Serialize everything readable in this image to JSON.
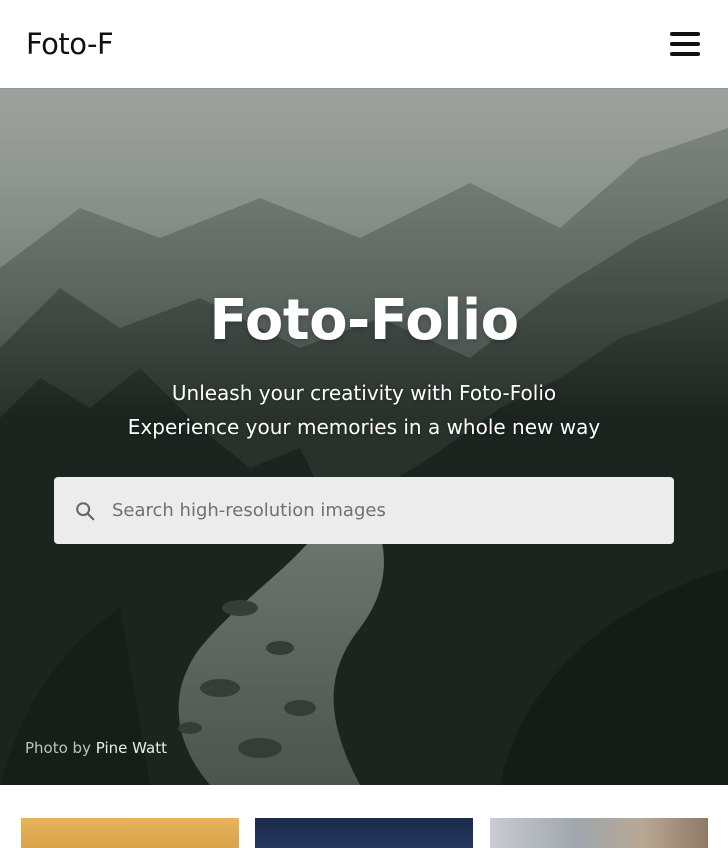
{
  "header": {
    "logo_text": "Foto-F",
    "menu_icon": "hamburger-menu-icon"
  },
  "hero": {
    "title": "Foto-Folio",
    "subtitle_line1": "Unleash your creativity with Foto-Folio",
    "subtitle_line2": "Experience your memories in a whole new way",
    "search": {
      "icon": "search-icon",
      "placeholder": "Search high-resolution images",
      "value": ""
    },
    "credit": {
      "prefix": "Photo by",
      "author": "Pine Watt"
    }
  },
  "gallery": {
    "thumbnails": [
      "thumbnail-1",
      "thumbnail-2",
      "thumbnail-3"
    ]
  },
  "colors": {
    "header_bg": "#ffffff",
    "text_dark": "#111111",
    "search_bg": "#ececec",
    "hero_overlay": "#2b342f"
  }
}
